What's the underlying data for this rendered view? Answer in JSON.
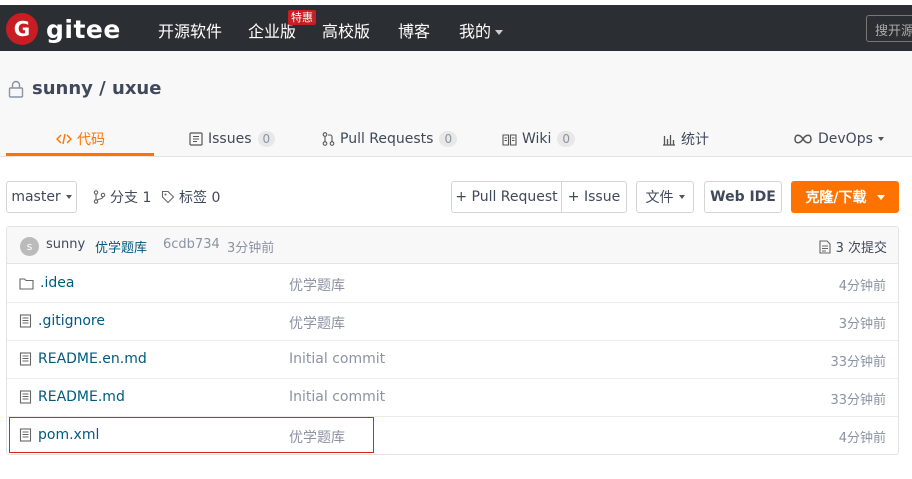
{
  "nav": {
    "logo_mark": "G",
    "logo_text": "gitee",
    "items": [
      "开源软件",
      "企业版",
      "高校版",
      "博客",
      "我的"
    ],
    "hot_badge": "特惠",
    "search_placeholder": "搜开源"
  },
  "repo": {
    "owner": "sunny",
    "separator": " / ",
    "name": "uxue"
  },
  "tabs": [
    {
      "label": "代码",
      "icon": "code-icon",
      "count": null,
      "active": true
    },
    {
      "label": "Issues",
      "icon": "issues-icon",
      "count": "0"
    },
    {
      "label": "Pull Requests",
      "icon": "pull-request-icon",
      "count": "0"
    },
    {
      "label": "Wiki",
      "icon": "wiki-icon",
      "count": "0"
    },
    {
      "label": "统计",
      "icon": "stats-icon",
      "count": null
    },
    {
      "label": "DevOps",
      "icon": "devops-icon",
      "count": null
    }
  ],
  "toolbar": {
    "branch": "master",
    "branches_label": "分支 1",
    "tags_label": "标签 0",
    "pull_request_btn": "+ Pull Request",
    "issue_btn": "+ Issue",
    "file_btn": "文件",
    "webide_btn": "Web IDE",
    "clone_btn": "克隆/下载"
  },
  "commit": {
    "avatar_letter": "s",
    "author": "sunny",
    "message": "优学题库",
    "hash": "6cdb734",
    "time": "3分钟前",
    "total": "3 次提交"
  },
  "files": [
    {
      "name": ".idea",
      "type": "folder",
      "message": "优学题库",
      "time": "4分钟前"
    },
    {
      "name": ".gitignore",
      "type": "file",
      "message": "优学题库",
      "time": "3分钟前"
    },
    {
      "name": "README.en.md",
      "type": "file",
      "message": "Initial commit",
      "time": "33分钟前"
    },
    {
      "name": "README.md",
      "type": "file",
      "message": "Initial commit",
      "time": "33分钟前"
    },
    {
      "name": "pom.xml",
      "type": "file",
      "message": "优学题库",
      "time": "4分钟前",
      "highlighted": true
    }
  ],
  "colors": {
    "nav_bg": "#2b2f33",
    "brand_red": "#c71d23",
    "accent_orange": "#fe7300",
    "link_blue": "#005980",
    "muted": "#8c92a4"
  }
}
